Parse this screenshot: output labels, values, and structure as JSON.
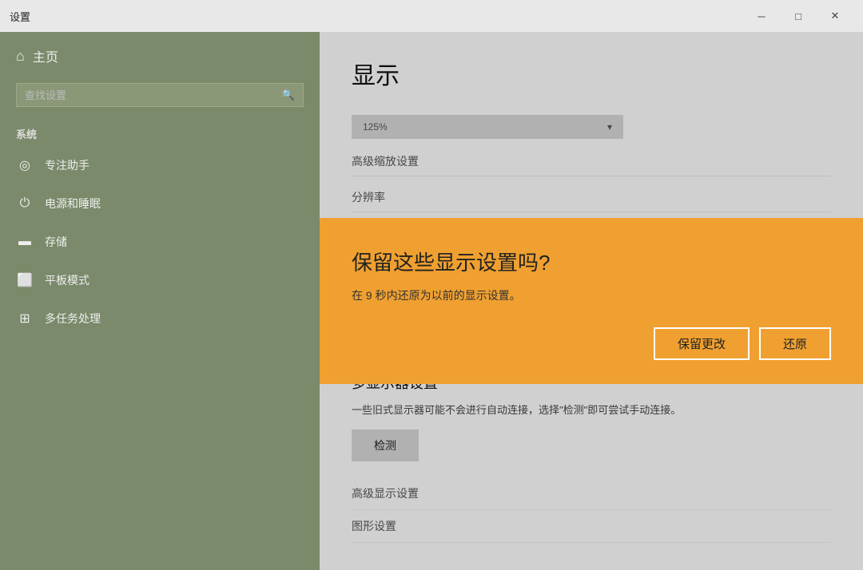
{
  "titleBar": {
    "title": "设置",
    "minimizeLabel": "─",
    "maximizeLabel": "□",
    "closeLabel": "✕"
  },
  "sidebar": {
    "homeLabel": "主页",
    "searchPlaceholder": "查找设置",
    "sectionLabel": "系统",
    "items": [
      {
        "id": "focus",
        "icon": "◎",
        "label": "专注助手"
      },
      {
        "id": "power",
        "icon": "⏻",
        "label": "电源和睡眠"
      },
      {
        "id": "storage",
        "icon": "▬",
        "label": "存储"
      },
      {
        "id": "tablet",
        "icon": "⬜",
        "label": "平板模式"
      },
      {
        "id": "multitask",
        "icon": "⊞",
        "label": "多任务处理"
      }
    ]
  },
  "content": {
    "title": "显示",
    "dropdownValue": "125%",
    "dropdownIcon": "▾",
    "advancedScalingLabel": "高级缩放设置",
    "resolutionLabel": "分辨率",
    "detectSectionTitle": "多显示器设置",
    "detectDesc": "一些旧式显示器可能不会进行自动连接，选择\"检测\"即可尝试手动连接。",
    "detectBtnLabel": "检测",
    "advancedDisplayLabel": "高级显示设置",
    "graphicsLabel": "图形设置"
  },
  "dialog": {
    "title": "保留这些显示设置吗?",
    "desc": "在 9 秒内还原为以前的显示设置。",
    "keepBtn": "保留更改",
    "revertBtn": "还原"
  }
}
